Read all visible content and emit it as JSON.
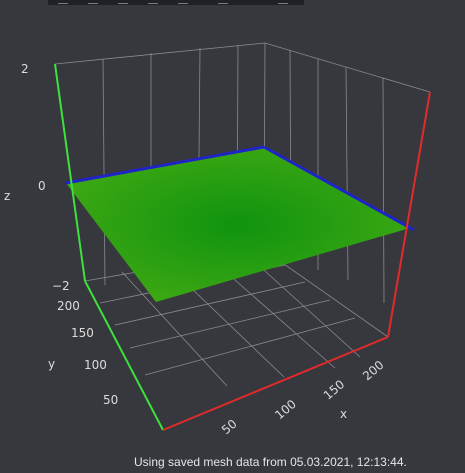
{
  "toolbar": {
    "icons": [
      "zoom-icon",
      "pan-icon",
      "rotate-icon",
      "reset-camera-icon",
      "orbit-icon",
      "screenshot-icon",
      "fullscreen-icon"
    ]
  },
  "axes": {
    "z_label": "z",
    "y_label": "y",
    "x_label": "x",
    "z_ticks": [
      "2",
      "0",
      "−2"
    ],
    "y_ticks": [
      "200",
      "150",
      "100",
      "50"
    ],
    "x_ticks": [
      "50",
      "100",
      "150",
      "200"
    ]
  },
  "colors": {
    "background": "#37383e",
    "grid": "#8a8b90",
    "axis_x": "#e02b2b",
    "axis_y": "#3ee03e",
    "axis_z": "#3ee03e",
    "mesh_edge": "#1f23c9",
    "mesh_center": "#129a12",
    "mesh_edge_fill": "#47ad12"
  },
  "status_text": "Using saved mesh data from 05.03.2021, 12:13:44."
}
